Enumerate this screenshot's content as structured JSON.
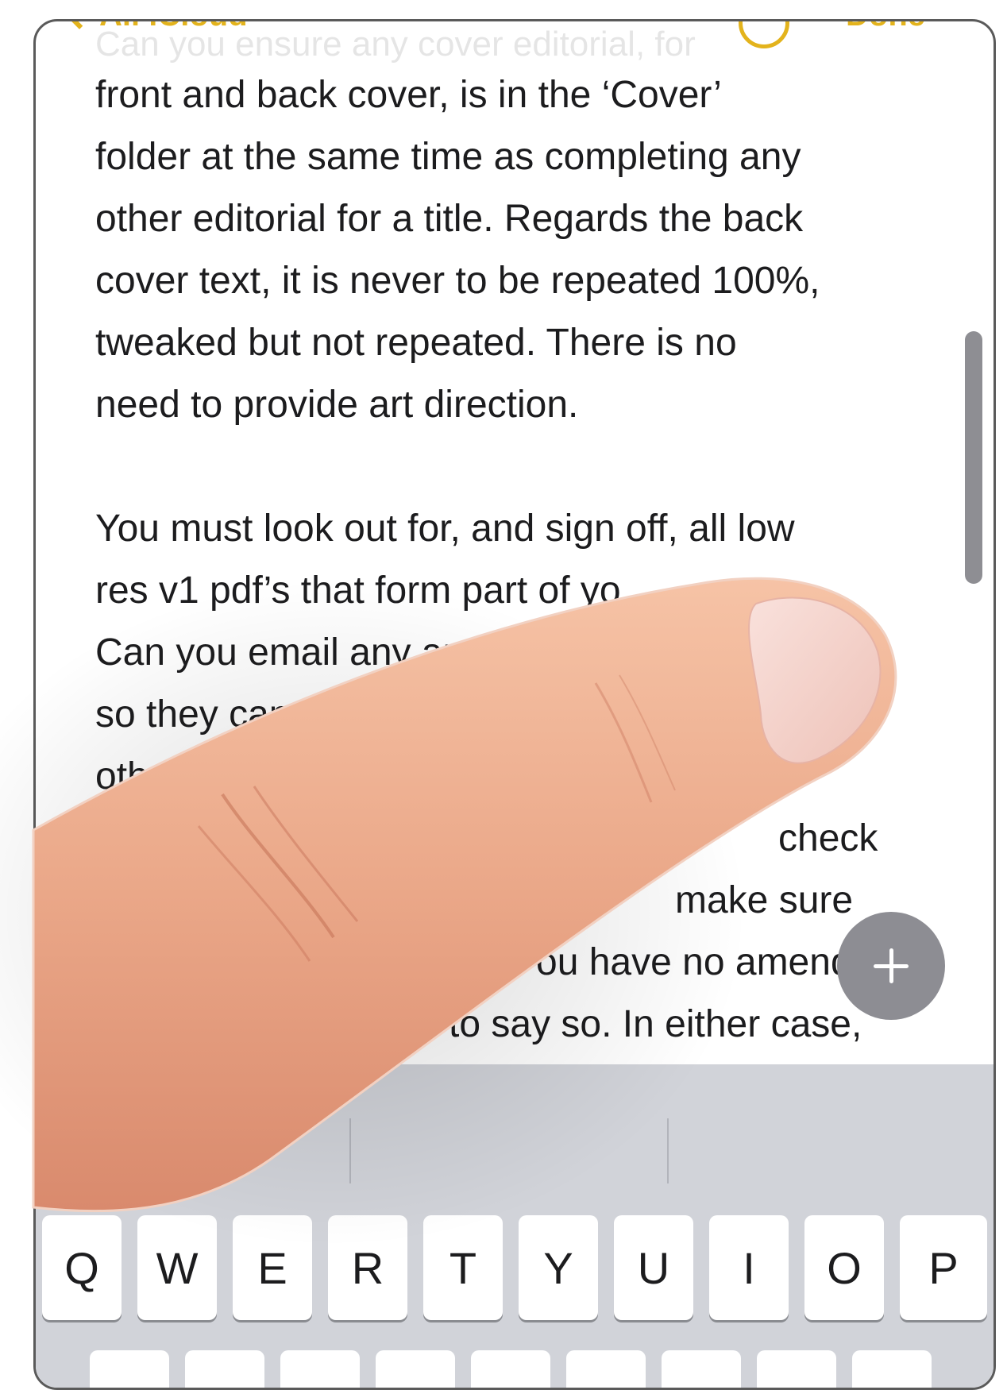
{
  "nav": {
    "back_label": "All iCloud",
    "done_label": "Done",
    "accent_color": "#e3b31c",
    "back_icon": "chevron-left-icon",
    "action_icon": "circle-icon"
  },
  "note": {
    "ghost_line": "Can you ensure any cover editorial, for",
    "lines": [
      "front and back cover, is in the ‘Cover’",
      "folder at the same time as completing any",
      "other editorial for a title. Regards the back",
      "cover text, it is never to be repeated 100%,",
      "tweaked but not repeated. There is no",
      "need to provide art direction.",
      "You must look out for, and sign off, all low",
      "res v1 pdf’s that form part of yo",
      "Can you email any ame",
      "so they can b",
      "other",
      "check",
      "make sure",
      "ou have no amend",
      "e to say so. In either case,"
    ]
  },
  "fab": {
    "icon": "plus-icon"
  },
  "keyboard": {
    "row1": [
      "Q",
      "W",
      "E",
      "R",
      "T",
      "Y",
      "U",
      "I",
      "O",
      "P"
    ]
  }
}
